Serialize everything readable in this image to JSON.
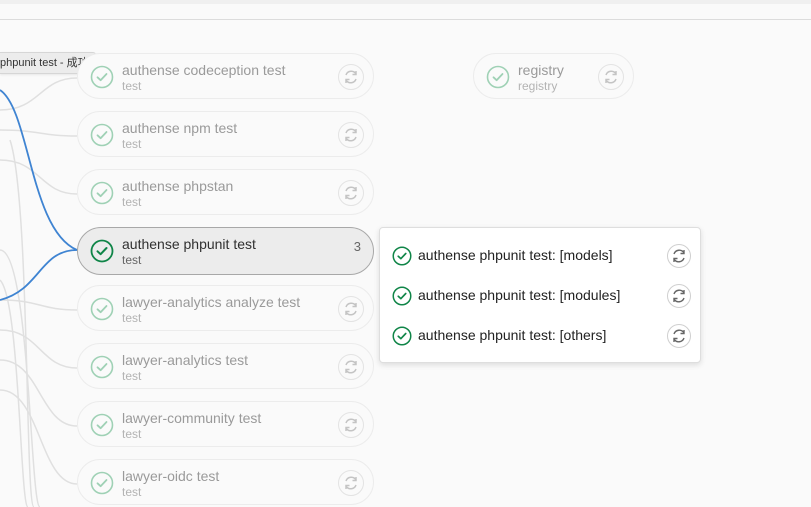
{
  "tooltip": {
    "text": "phpunit test - 成功"
  },
  "jobs": [
    {
      "name": "authense codeception test",
      "stage": "test"
    },
    {
      "name": "authense npm test",
      "stage": "test"
    },
    {
      "name": "authense phpstan",
      "stage": "test"
    },
    {
      "name": "authense phpunit test",
      "stage": "test",
      "count": "3"
    },
    {
      "name": "lawyer-analytics analyze test",
      "stage": "test"
    },
    {
      "name": "lawyer-analytics test",
      "stage": "test"
    },
    {
      "name": "lawyer-community test",
      "stage": "test"
    },
    {
      "name": "lawyer-oidc test",
      "stage": "test"
    }
  ],
  "registry": {
    "name": "registry",
    "stage": "registry"
  },
  "popup": {
    "items": [
      {
        "label": "authense phpunit test: [models]"
      },
      {
        "label": "authense phpunit test: [modules]"
      },
      {
        "label": "authense phpunit test: [others]"
      }
    ]
  },
  "colors": {
    "success": "#108548",
    "success_faded": "#9fd1b5",
    "link_active": "#3f84d2",
    "link_inactive": "#dddddd"
  },
  "icons": {
    "status": "check-circle-icon",
    "retry": "retry-icon"
  }
}
